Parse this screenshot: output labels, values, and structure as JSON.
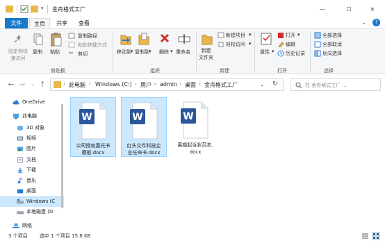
{
  "window": {
    "title": "金舟格式工厂",
    "controls": [
      "—",
      "☐",
      "✕"
    ]
  },
  "ribbon_tabs": [
    "文件",
    "主页",
    "共享",
    "查看"
  ],
  "ribbon": {
    "clipboard": {
      "pin_label": "固定到快\n速访问",
      "copy_label": "复制",
      "paste_label": "粘贴",
      "copy_path": "复制路径",
      "paste_shortcut": "粘贴快捷方式",
      "cut": "剪切",
      "group": "剪贴板"
    },
    "organize": {
      "move_to": "移动到",
      "copy_to": "复制到",
      "delete": "删除",
      "rename": "重命名",
      "group": "组织"
    },
    "new": {
      "new_folder": "新建\n文件夹",
      "new_item": "新建项目",
      "easy_access": "轻松访问",
      "group": "新建"
    },
    "open": {
      "properties": "属性",
      "open": "打开",
      "edit": "编辑",
      "history": "历史记录",
      "group": "打开"
    },
    "select": {
      "select_all": "全部选择",
      "select_none": "全部取消",
      "invert": "反向选择",
      "group": "选择"
    }
  },
  "address": {
    "crumbs": [
      "此电脑",
      "Windows (C:)",
      "用户",
      "admin",
      "桌面",
      "金舟格式工厂"
    ],
    "search_placeholder": "在 金舟格式工厂 ..."
  },
  "nav": [
    {
      "label": "OneDrive",
      "icon": "cloud-icon"
    },
    {
      "label": "此电脑",
      "icon": "computer-icon"
    },
    {
      "label": "3D 对象",
      "icon": "cube-icon"
    },
    {
      "label": "视频",
      "icon": "video-icon"
    },
    {
      "label": "图片",
      "icon": "picture-icon"
    },
    {
      "label": "文档",
      "icon": "document-icon"
    },
    {
      "label": "下载",
      "icon": "download-icon"
    },
    {
      "label": "音乐",
      "icon": "music-icon"
    },
    {
      "label": "桌面",
      "icon": "desktop-icon"
    },
    {
      "label": "Windows (C",
      "icon": "drive-icon"
    },
    {
      "label": "本地磁盘 (D",
      "icon": "drive-icon"
    },
    {
      "label": "网络",
      "icon": "network-icon"
    }
  ],
  "files": [
    {
      "name": "公司授权委托书\n模板.docx",
      "selected": true
    },
    {
      "name": "红头文件科技企\n业任命书.docx",
      "selected": true
    },
    {
      "name": "离婚起诉状范本.\ndocx",
      "selected": false
    }
  ],
  "status": {
    "count": "3 个项目",
    "selection": "选中 1 个项目  15.8 KB"
  },
  "colors": {
    "accent": "#1979ca",
    "selection": "#cce8ff",
    "word_blue": "#2b579a"
  }
}
